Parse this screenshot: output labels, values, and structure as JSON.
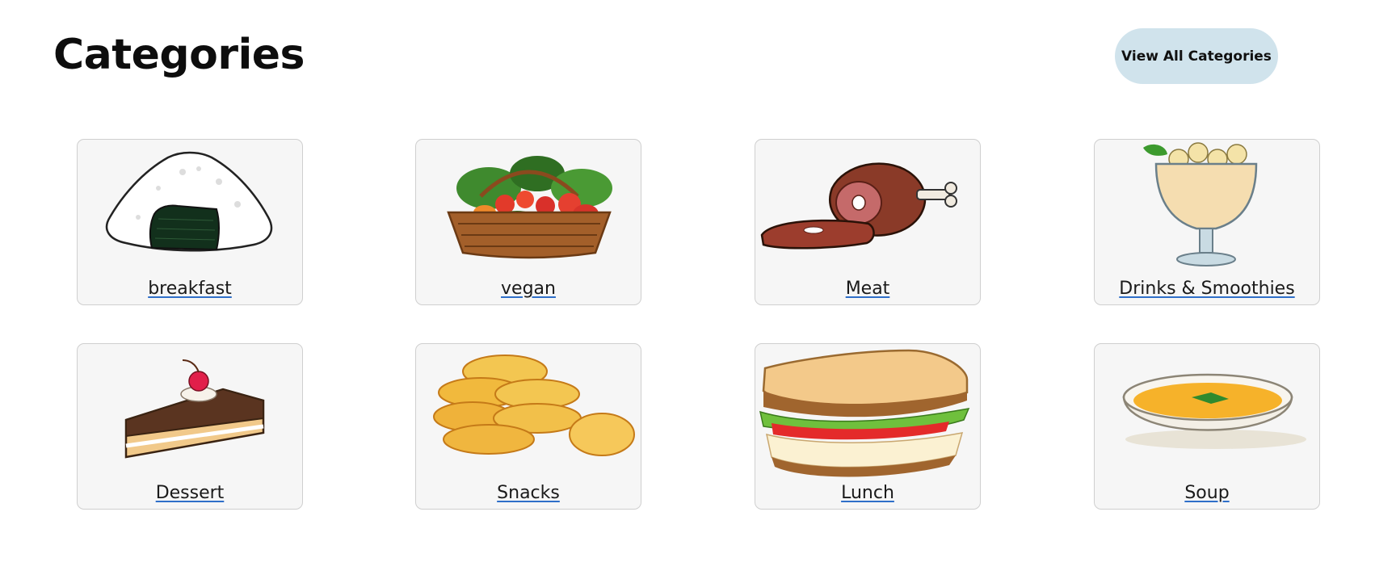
{
  "header": {
    "title": "Categories",
    "view_all_label": "View All Categories"
  },
  "colors": {
    "button_bg": "#d0e3ec",
    "card_bg": "#f6f6f6",
    "link_underline": "#2f6fc9"
  },
  "categories": [
    {
      "label": "breakfast",
      "icon": "onigiri-icon"
    },
    {
      "label": "vegan",
      "icon": "vegetable-basket-icon"
    },
    {
      "label": "Meat",
      "icon": "ham-leg-icon"
    },
    {
      "label": "Drinks & Smoothies",
      "icon": "banana-smoothie-icon"
    },
    {
      "label": "Dessert",
      "icon": "cake-slice-icon"
    },
    {
      "label": "Snacks",
      "icon": "chips-icon"
    },
    {
      "label": "Lunch",
      "icon": "sandwich-icon"
    },
    {
      "label": "Soup",
      "icon": "soup-bowl-icon"
    }
  ]
}
